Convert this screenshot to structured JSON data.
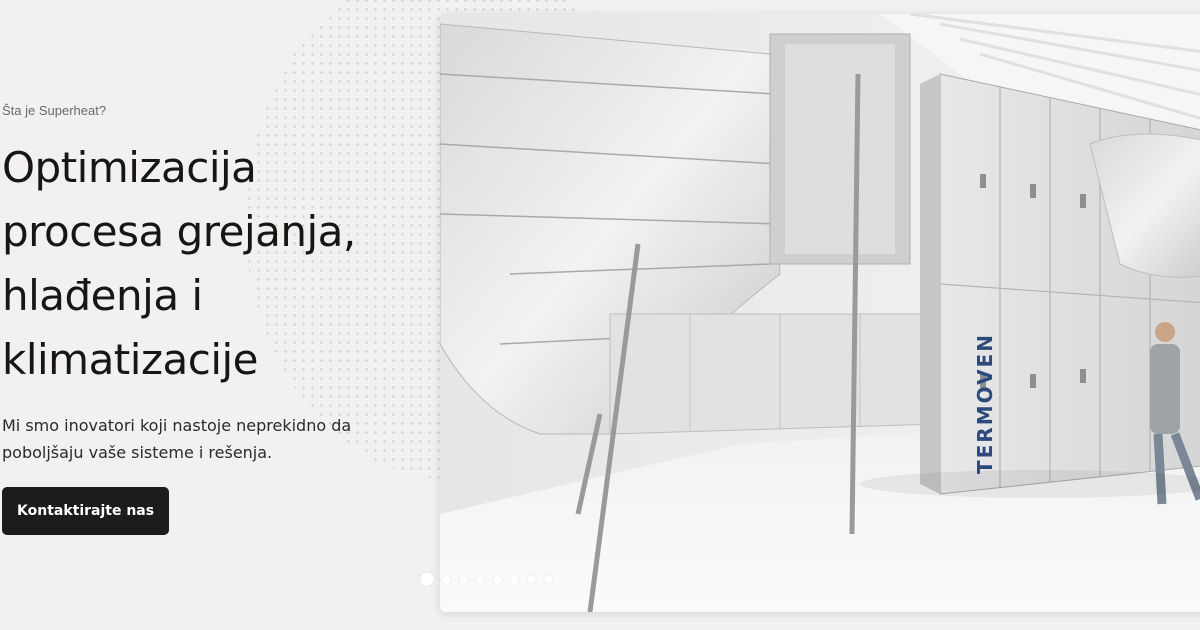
{
  "hero": {
    "eyebrow": "Šta je Superheat?",
    "headline_lines": [
      "Optimizacija",
      "procesa grejanja,",
      "hlađenja i",
      "klimatizacije"
    ],
    "subtext_lines": [
      "Mi smo inovatori koji nastoje neprekidno da",
      "poboljšaju vaše sisteme i rešenja."
    ],
    "cta_label": "Kontaktirajte nas"
  },
  "image": {
    "brand_text": "TERMOVEN",
    "description_icon": "hvac-photo"
  },
  "carousel": {
    "slide_count": 8,
    "active_index": 0
  },
  "colors": {
    "background": "#f2f1ef",
    "text": "#161616",
    "button": "#1c1c1c",
    "button_text": "#ffffff"
  }
}
